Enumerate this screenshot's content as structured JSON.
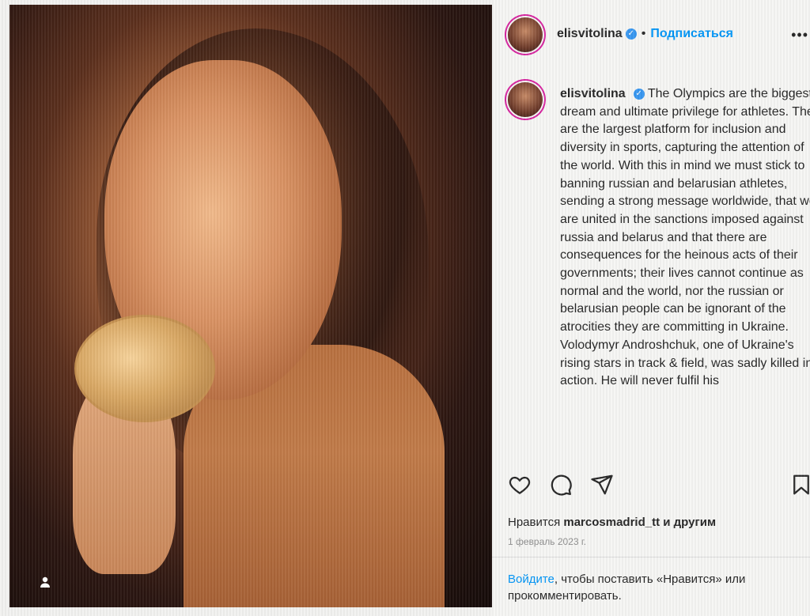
{
  "post": {
    "username": "elisvitolina",
    "follow_label": "Подписаться",
    "more_label": "•••",
    "separator": "•",
    "caption": "The Olympics are the biggest dream and ultimate privilege for athletes. They are the largest platform for inclusion and diversity in sports, capturing the attention of the world. With this in mind we must stick to banning russian and belarusian athletes, sending a strong message worldwide, that we are united in the sanctions imposed against russia and belarus and that there are consequences for the heinous acts of their governments; their lives cannot continue as normal and the world, nor the russian or belarusian people can be ignorant of the atrocities they are committing in Ukraine. Volodymyr Androshchuk, one of Ukraine's rising stars in track & field, was sadly killed in action. He will never fulfil his",
    "likes_prefix": "Нравится",
    "likes_user": "marcosmadrid_tt",
    "likes_suffix": "и другим",
    "date": "1 февраль 2023 г.",
    "login_link": "Войдите",
    "login_text": ", чтобы поставить «Нравится» или прокомментировать."
  },
  "icons": {
    "like": "heart-icon",
    "comment": "comment-icon",
    "share": "share-icon",
    "save": "bookmark-icon",
    "verified": "verified-badge-icon",
    "tagged_user": "person-icon"
  },
  "colors": {
    "link": "#0095f6",
    "verified": "#3897f0",
    "text": "#262626",
    "muted": "#8e8e8e"
  }
}
